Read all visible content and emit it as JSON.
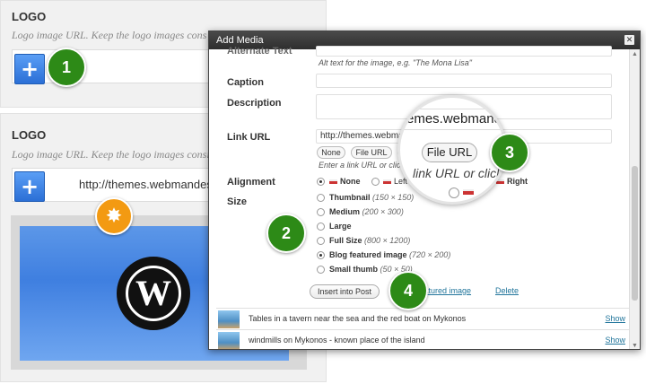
{
  "panel_top": {
    "title": "LOGO",
    "description": "Logo image URL. Keep the logo images cons",
    "add_button": "+"
  },
  "panel_bottom": {
    "title": "LOGO",
    "description": "Logo image URL. Keep the logo images consistent",
    "add_button": "+",
    "url_value": "http://themes.webmandesign",
    "preview_logo_glyph": "W"
  },
  "callouts": {
    "one": "1",
    "two": "2",
    "three": "3",
    "four": "4",
    "star": "✸"
  },
  "modal": {
    "title": "Add Media",
    "close": "✕",
    "alt_text": {
      "label": "Alternate Text",
      "hint": "Alt text for the image, e.g. \"The Mona Lisa\""
    },
    "caption": {
      "label": "Caption",
      "value": ""
    },
    "description": {
      "label": "Description",
      "value": ""
    },
    "link_url": {
      "label": "Link URL",
      "value": "http://themes.webmandes",
      "buttons": [
        "None",
        "File URL",
        "P"
      ],
      "hint": "Enter a link URL or click a"
    },
    "alignment": {
      "label": "Alignment",
      "options": [
        "None",
        "Left",
        "Right"
      ],
      "selected": "None"
    },
    "size": {
      "label": "Size",
      "options": [
        {
          "name": "Thumbnail",
          "dims": "(150 × 150)"
        },
        {
          "name": "Medium",
          "dims": "(200 × 300)"
        },
        {
          "name": "Large",
          "dims": ""
        },
        {
          "name": "Full Size",
          "dims": "(800 × 1200)"
        },
        {
          "name": "Blog featured image",
          "dims": "(720 × 200)"
        },
        {
          "name": "Small thumb",
          "dims": "(50 × 50)"
        }
      ],
      "selected": "Blog featured image"
    },
    "insert_button": "Insert into Post",
    "featured_link": "featured image",
    "delete_link": "Delete",
    "media_items": [
      {
        "title": "Tables in a tavern near the sea and the red boat on Mykonos",
        "action": "Show"
      },
      {
        "title": "windmills on Mykonos - known place of the island",
        "action": "Show"
      }
    ]
  },
  "magnifier": {
    "url_text": "emes.webmande",
    "button": "File URL",
    "hint": "link URL or click"
  }
}
